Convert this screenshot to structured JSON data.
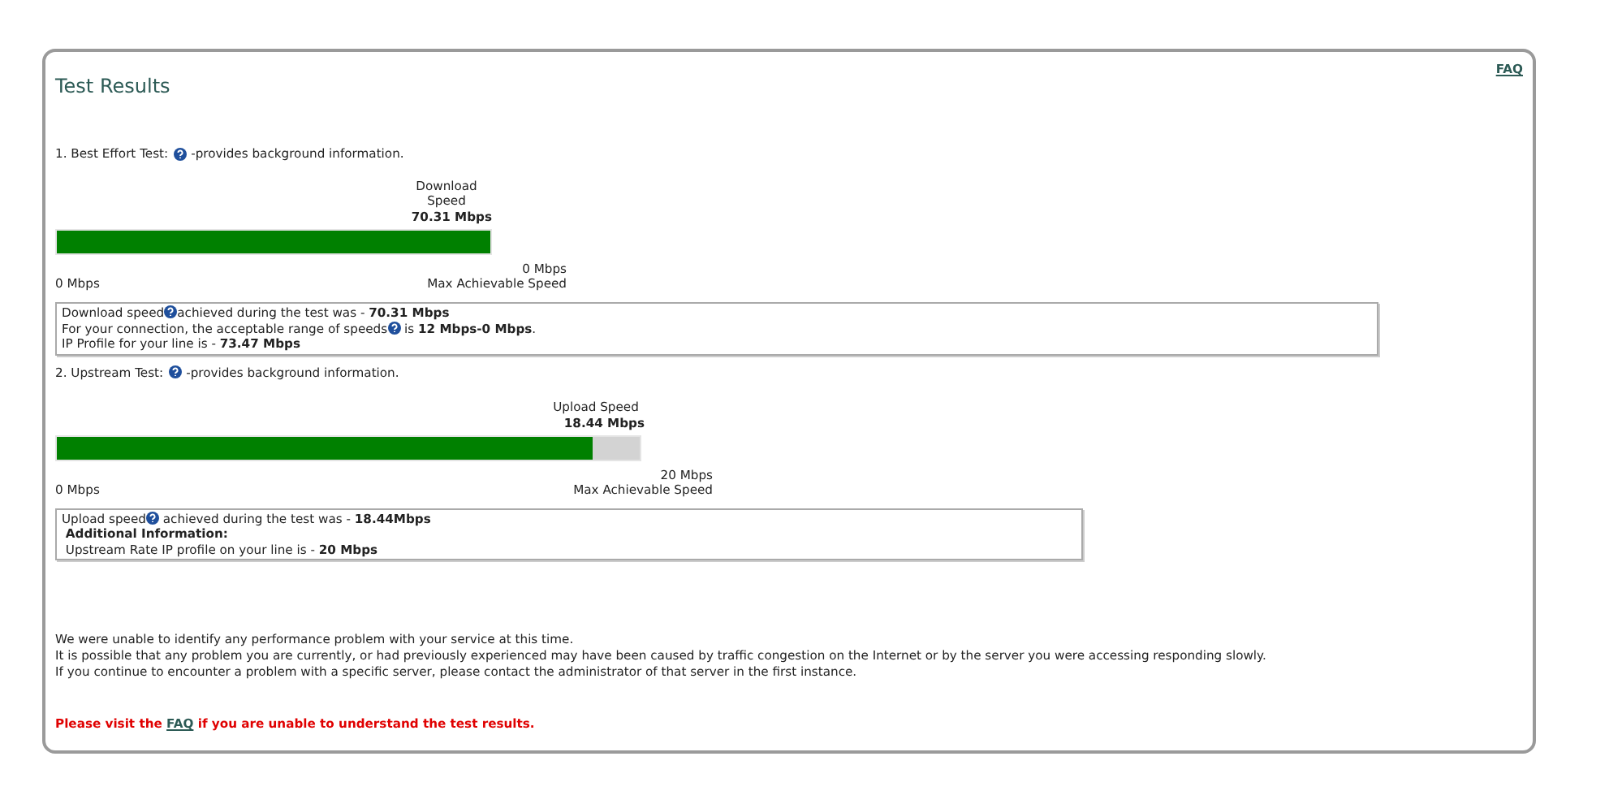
{
  "panel": {
    "title": "Test Results",
    "faq_link": "FAQ"
  },
  "tests": [
    {
      "heading_before": "1. Best Effort Test:",
      "heading_after": "-provides background information.",
      "gauge_label": "Download Speed",
      "gauge_value": "70.31 Mbps",
      "level": 1,
      "min_label": "0 Mbps",
      "max_value": "0 Mbps",
      "max_label": "Max Achievable Speed",
      "info": [
        {
          "before": "Download speed",
          "after": "achieved during the test was - **70.31 Mbps**"
        },
        {
          "before": "For your connection, the acceptable range of speeds",
          "after": " is **12 Mbps-0 Mbps**."
        },
        {
          "before": "IP Profile for your line is - **73.47 Mbps**"
        }
      ]
    },
    {
      "heading_before": "2. Upstream Test:",
      "heading_after": "-provides background information.",
      "gauge_label": "Upload Speed",
      "gauge_value": "18.44 Mbps",
      "level": 0.92,
      "min_label": "0 Mbps",
      "max_value": "20 Mbps",
      "max_label": "Max Achievable Speed",
      "info": [
        {
          "before": "Upload speed",
          "after": " achieved during the test was - **18.44Mbps**"
        },
        {
          "before": " **Additional Information:**"
        },
        {
          "before": " Upstream Rate IP profile on your line is - **20 Mbps**"
        }
      ]
    }
  ],
  "summary": [
    "We were unable to identify any performance problem with your service at this time.",
    "It is possible that any problem you are currently, or had previously experienced may have been caused by traffic congestion on the Internet or by the server you were accessing responding slowly.",
    "If you continue to encounter a problem with a specific server, please contact the administrator of that server in the first instance."
  ],
  "notice": {
    "before": "Please visit the ",
    "link": "FAQ",
    "after": " if you are unable to understand the test results."
  }
}
